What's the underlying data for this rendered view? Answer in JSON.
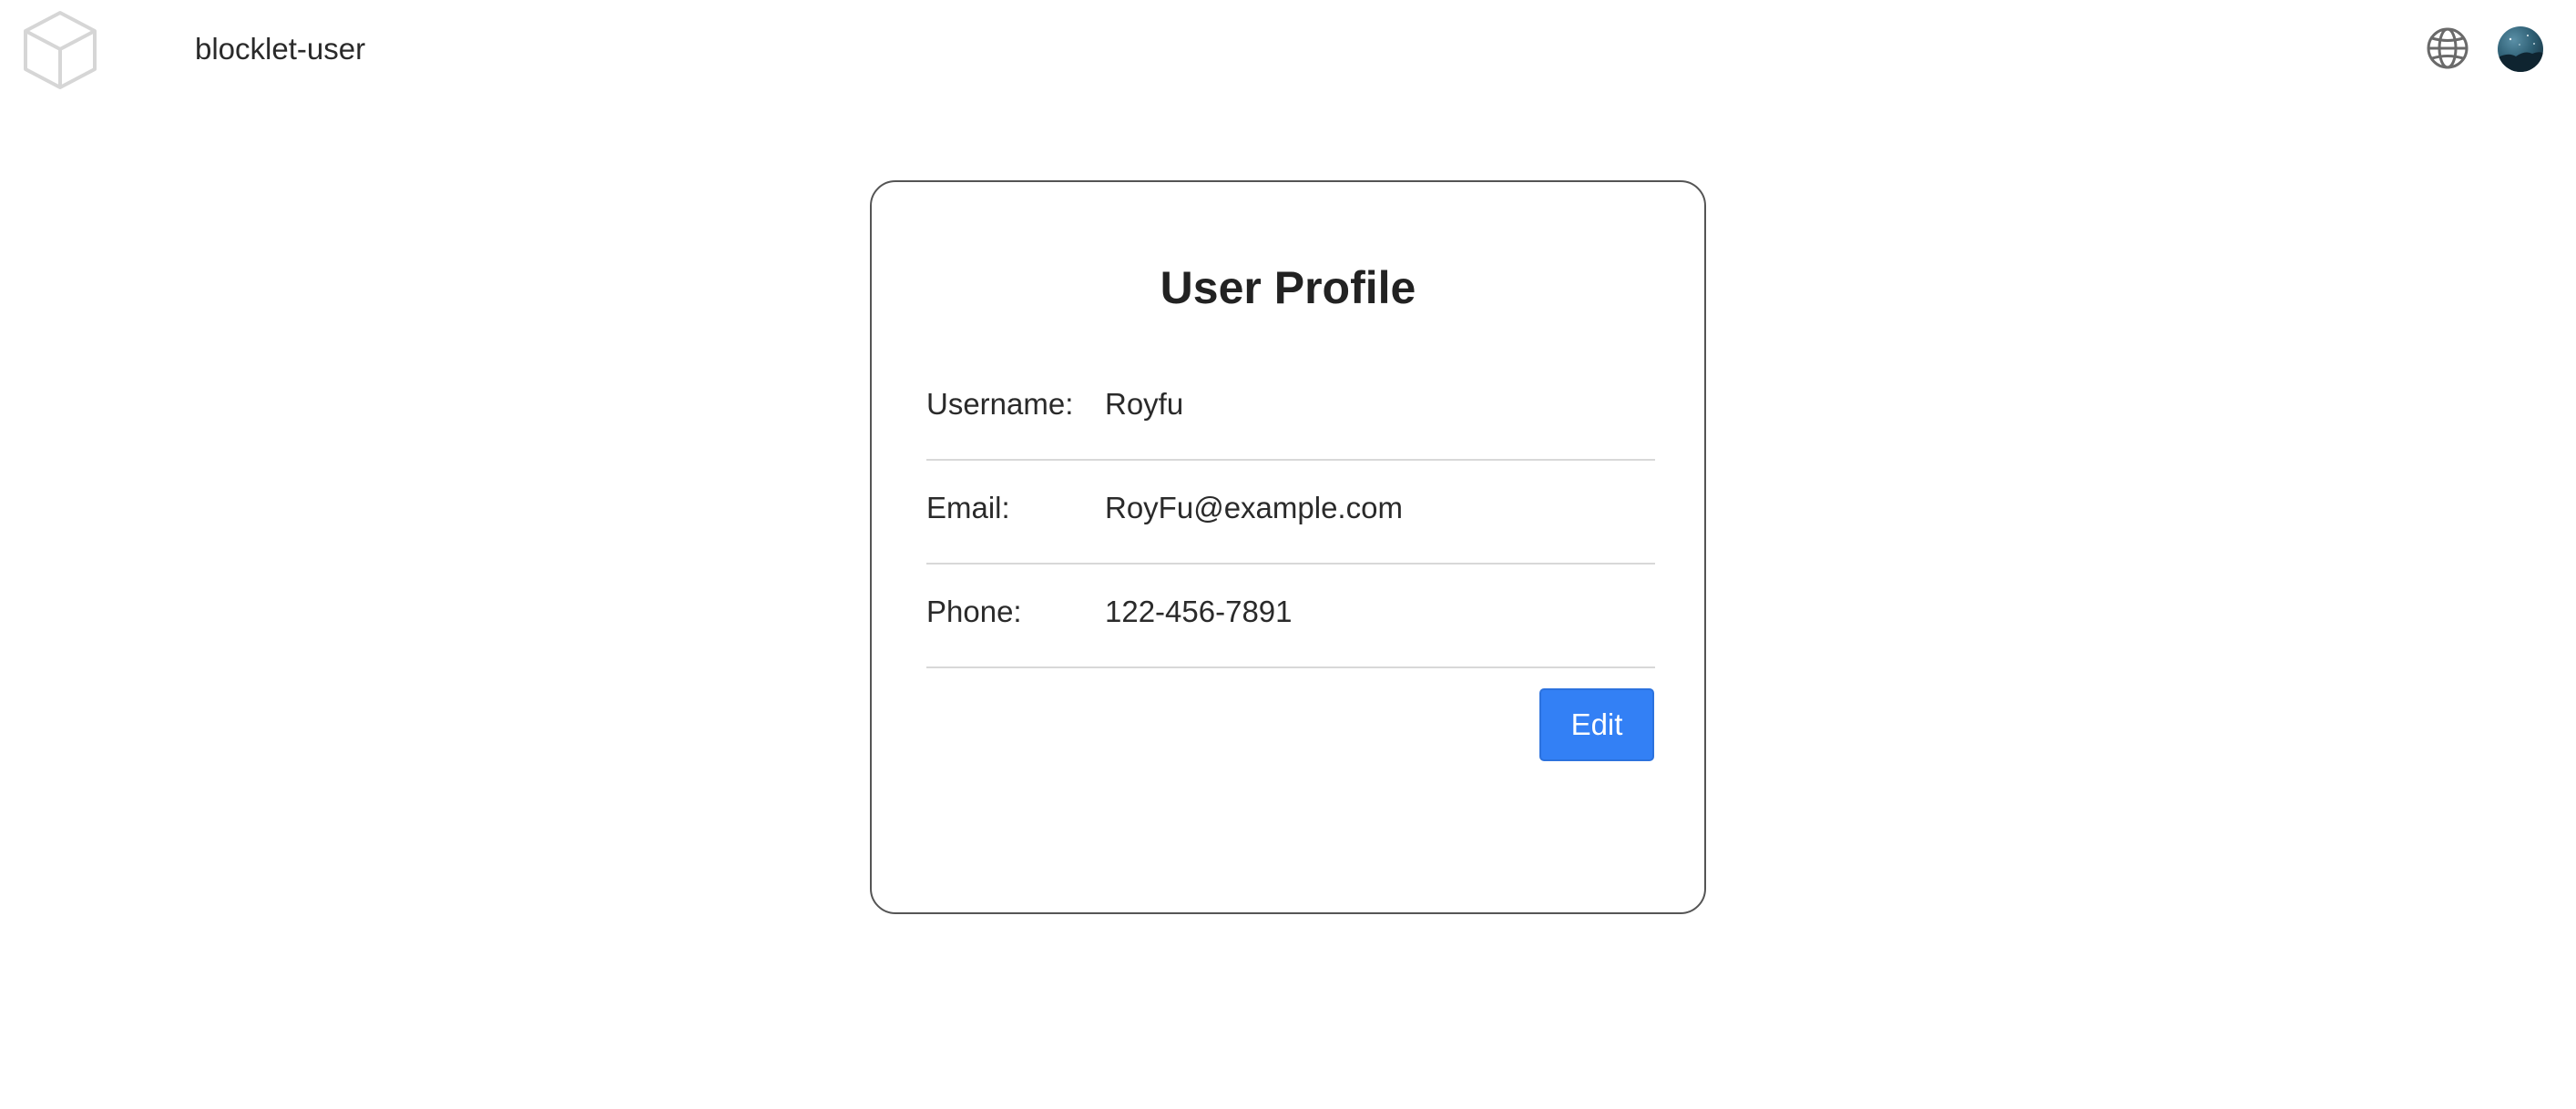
{
  "header": {
    "logo_icon": "cube-icon",
    "app_title": "blocklet-user",
    "language_icon": "globe-icon",
    "avatar_icon": "user-avatar"
  },
  "profile": {
    "title": "User Profile",
    "fields": [
      {
        "label": "Username:",
        "value": "Royfu"
      },
      {
        "label": "Email:",
        "value": "RoyFu@example.com"
      },
      {
        "label": "Phone:",
        "value": "122-456-7891"
      }
    ],
    "edit_label": "Edit"
  },
  "colors": {
    "accent": "#3380f5",
    "card_border": "#555555",
    "divider": "#d8d8d8"
  }
}
